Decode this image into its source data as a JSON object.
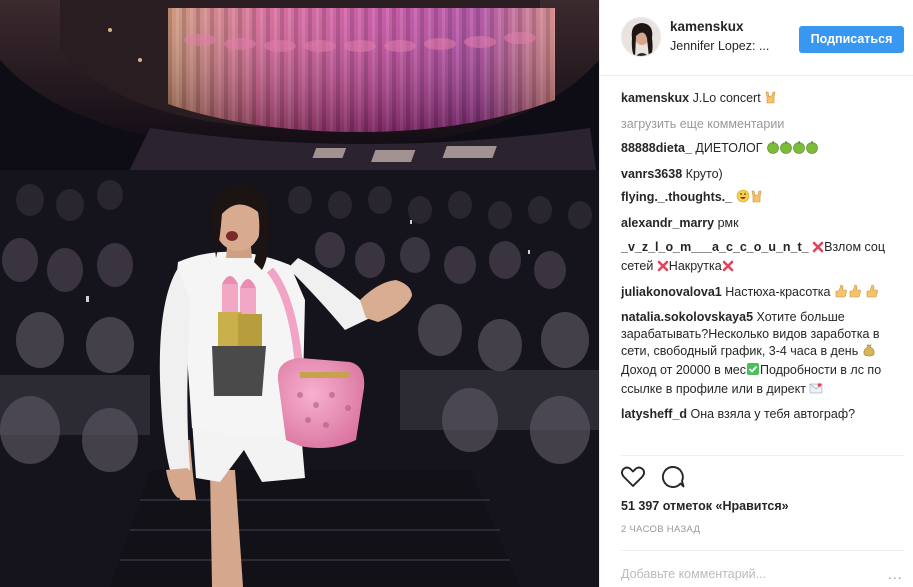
{
  "post": {
    "username": "kamenskux",
    "location": "Jennifer Lopez: ...",
    "follow_label": "Подписаться",
    "caption_user": "kamenskux",
    "caption_text": "J.Lo concert",
    "load_more_label": "загрузить еще комментарии",
    "likes_text": "51 397 отметок «Нравится»",
    "time_text": "2 ЧАСОВ НАЗАД",
    "add_comment_placeholder": "Добавьте комментарий...",
    "more_label": "..."
  },
  "comments": [
    {
      "user": "88888dieta_",
      "text": "ДИЕТОЛОГ",
      "emoji": "green-apple-icon"
    },
    {
      "user": "vanrs3638",
      "text": "Круто)"
    },
    {
      "user": "flying._.thoughts._",
      "text": "",
      "emoji": "grinning-sweat-icon"
    },
    {
      "user": "alexandr_marry",
      "text": "рмк"
    },
    {
      "user": "_v_z_l_o_m___a_c_c_o_u_n_t_",
      "text_1": "Взлом соц сетей",
      "text_2": "Накрутка",
      "emoji": "cross-mark-icon"
    },
    {
      "user": "juliakonovalova1",
      "text": "Настюха-красотка",
      "emoji": "thumbs-up-icon"
    },
    {
      "user": "natalia.sokolovskaya5",
      "text_1": "Хотите больше зарабатывать?Несколько видов заработка в сети, свободный график, 3-4 часа в день",
      "text_2": "Доход от 20000 в мес",
      "text_3": "Подробности в лс по ссылке в профиле или в директ",
      "emoji": "money-bag-icon"
    },
    {
      "user": "latysheff_d",
      "text": "Она взяла у тебя автограф?"
    }
  ],
  "colors": {
    "accent": "#3897f0",
    "text": "#262626",
    "muted": "#999999",
    "divider": "#efefef"
  }
}
